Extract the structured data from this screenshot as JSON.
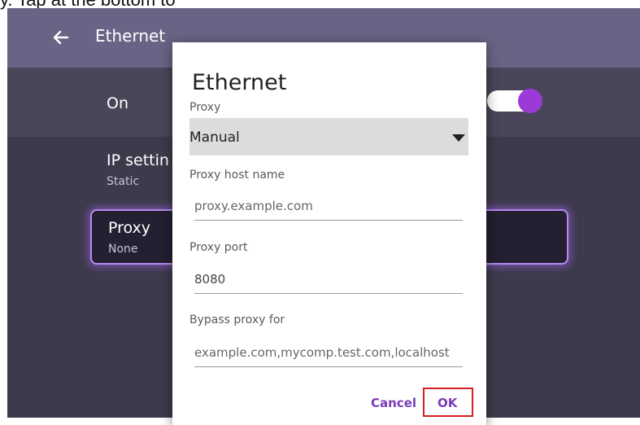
{
  "page_caption": "y. Tap at the bottom to",
  "appbar": {
    "title": "Ethernet",
    "back_icon": "arrow-left-icon"
  },
  "settings": {
    "on_label": "On",
    "toggle_on": true,
    "ip_settings_label": "IP settin",
    "ip_settings_value": "Static",
    "proxy_label": "Proxy",
    "proxy_value": "None"
  },
  "dialog": {
    "title": "Ethernet",
    "proxy_label": "Proxy",
    "proxy_mode": "Manual",
    "host_label": "Proxy host name",
    "host_placeholder": "proxy.example.com",
    "port_label": "Proxy port",
    "port_value": "8080",
    "bypass_label": "Bypass proxy for",
    "bypass_placeholder": "example.com,mycomp.test.com,localhost",
    "cancel_label": "Cancel",
    "ok_label": "OK"
  },
  "colors": {
    "accent": "#7b3cba",
    "toggle_thumb": "#9b3ad6",
    "highlight_box": "#d62020",
    "appbar": "#6b6385",
    "background": "#3d3a4b"
  }
}
